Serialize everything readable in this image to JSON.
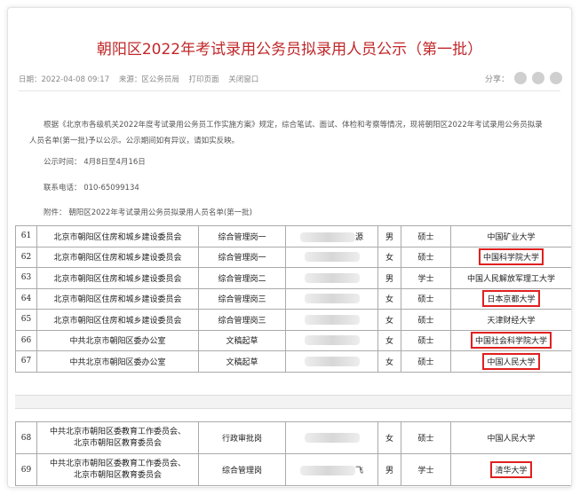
{
  "article": {
    "title": "朝阳区2022年考试录用公务员拟录用人员公示（第一批）",
    "meta": {
      "date": "日期：2022-04-08 09:17",
      "source": "来源：区公务员局",
      "print": "打印页面",
      "close": "关闭窗口"
    },
    "share_label": "分享：",
    "paragraph_line1": "根据《北京市各级机关2022年度考试录用公务员工作实施方案》规定，综合笔试、面试、体检和考察等情况，现将朝阳区2022年考试录用公务员拟录",
    "paragraph_line2": "人员名单(第一批)予以公示。公示期间如有异议，请如实反映。",
    "period": "公示时间： 4月8日至4月16日",
    "phone": "联系电话： 010-65099134",
    "attachment": "附件： 朝阳区2022年考试录用公务员拟录用人员名单(第一批)"
  },
  "table_top": [
    {
      "no": "61",
      "org": "北京市朝阳区住房和城乡建设委员会",
      "post": "综合管理岗一",
      "name_tail": "源",
      "gender": "男",
      "degree": "硕士",
      "school": "中国矿业大学",
      "hl": false
    },
    {
      "no": "62",
      "org": "北京市朝阳区住房和城乡建设委员会",
      "post": "综合管理岗一",
      "name_tail": "",
      "gender": "女",
      "degree": "硕士",
      "school": "中国科学院大学",
      "hl": true
    },
    {
      "no": "63",
      "org": "北京市朝阳区住房和城乡建设委员会",
      "post": "综合管理岗二",
      "name_tail": "",
      "gender": "男",
      "degree": "学士",
      "school": "中国人民解放军理工大学",
      "hl": false
    },
    {
      "no": "64",
      "org": "北京市朝阳区住房和城乡建设委员会",
      "post": "综合管理岗三",
      "name_tail": "",
      "gender": "女",
      "degree": "硕士",
      "school": "日本京都大学",
      "hl": true
    },
    {
      "no": "65",
      "org": "北京市朝阳区住房和城乡建设委员会",
      "post": "综合管理岗三",
      "name_tail": "",
      "gender": "女",
      "degree": "硕士",
      "school": "天津财经大学",
      "hl": false
    },
    {
      "no": "66",
      "org": "中共北京市朝阳区委办公室",
      "post": "文稿起草",
      "name_tail": "",
      "gender": "女",
      "degree": "硕士",
      "school": "中国社会科学院大学",
      "hl": true
    },
    {
      "no": "67",
      "org": "中共北京市朝阳区委办公室",
      "post": "文稿起草",
      "name_tail": "",
      "gender": "女",
      "degree": "硕士",
      "school": "中国人民大学",
      "hl": true
    }
  ],
  "table_bottom": [
    {
      "no": "68",
      "org1": "中共北京市朝阳区委教育工作委员会、",
      "org2": "北京市朝阳区教育委员会",
      "post": "行政审批岗",
      "name_tail": "",
      "gender": "女",
      "degree": "硕士",
      "school": "中国人民大学",
      "hl": false
    },
    {
      "no": "69",
      "org1": "中共北京市朝阳区委教育工作委员会、",
      "org2": "北京市朝阳区教育委员会",
      "post": "综合管理岗",
      "name_tail": "飞",
      "gender": "男",
      "degree": "学士",
      "school": "清华大学",
      "hl": true
    }
  ],
  "colors": {
    "title": "#c0282a",
    "highlight": "#e02020"
  }
}
